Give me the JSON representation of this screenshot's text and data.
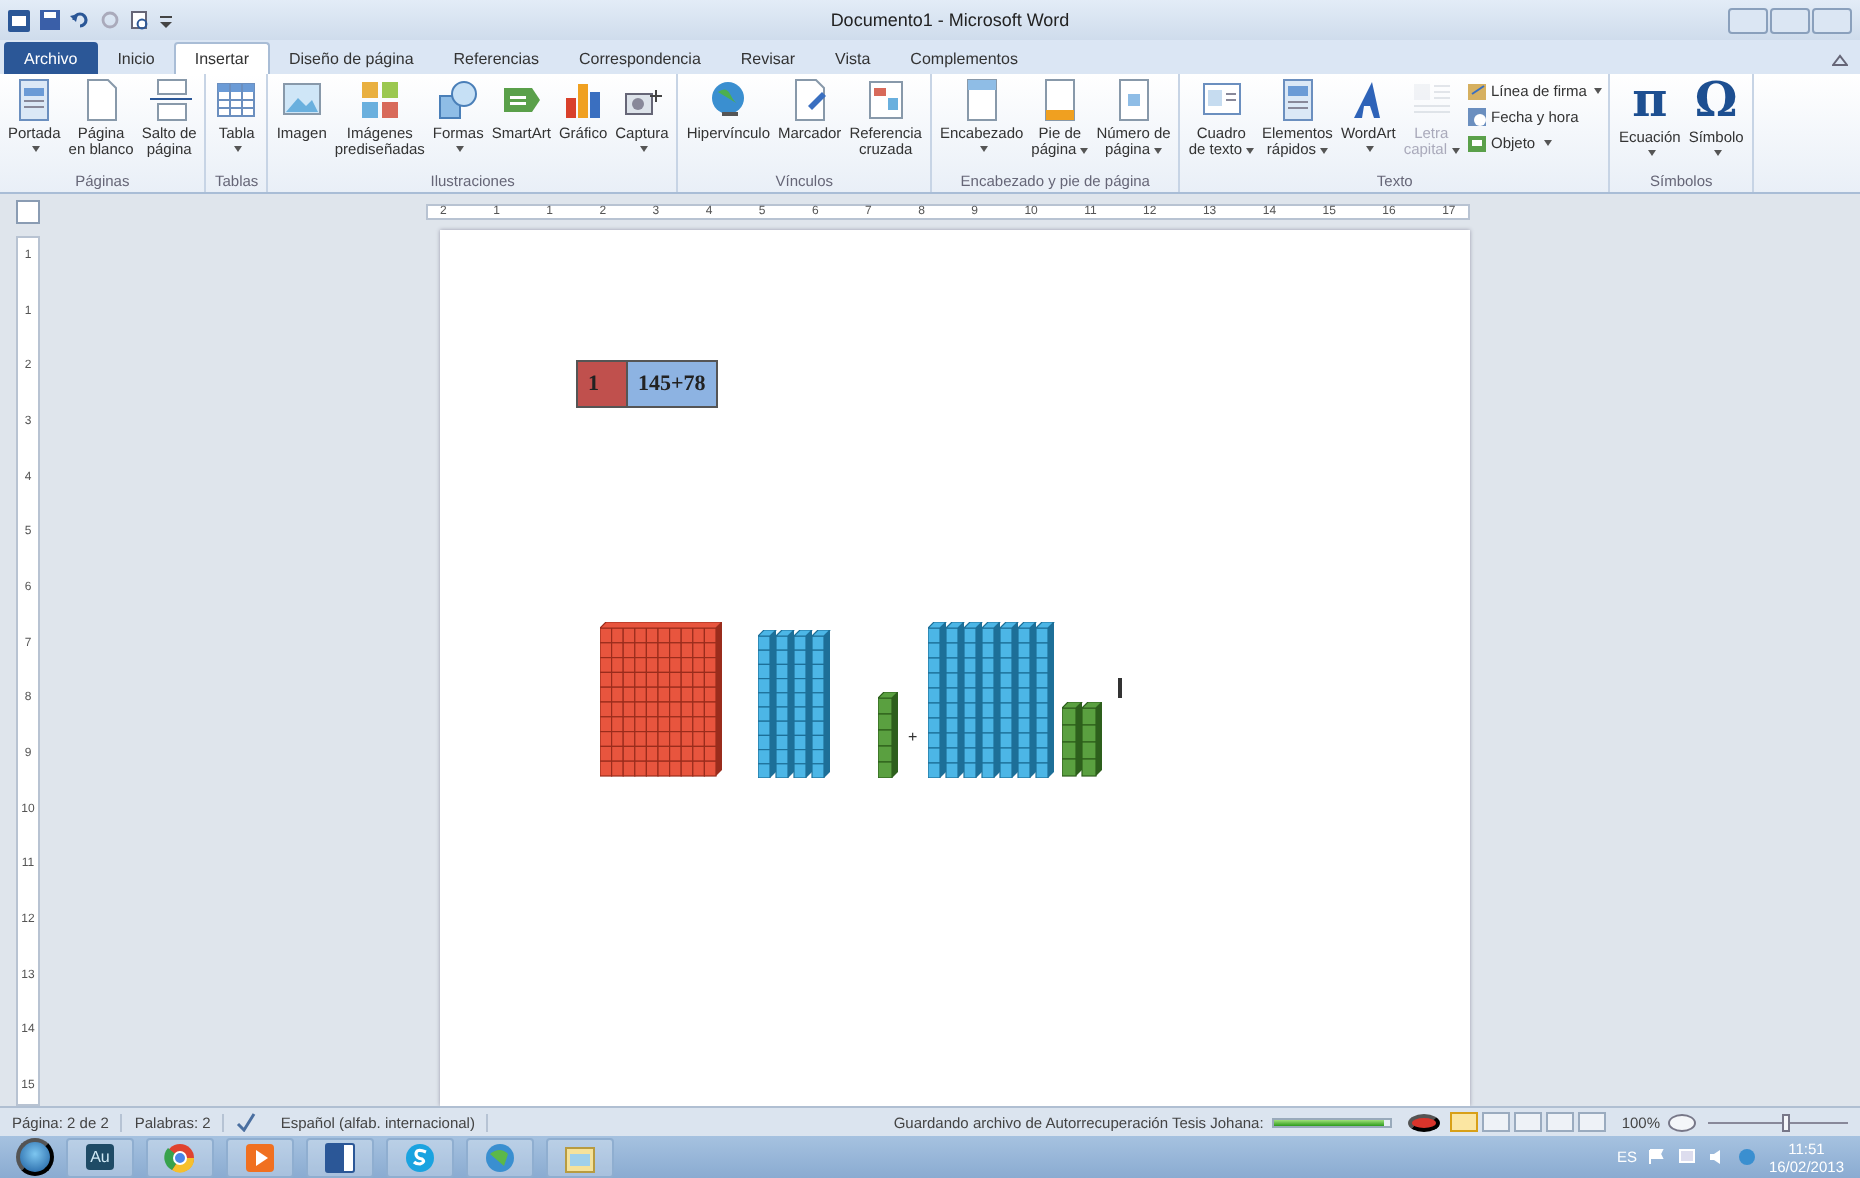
{
  "title_bar": {
    "title": "Documento1 - Microsoft Word"
  },
  "tabs": [
    {
      "label": "Archivo",
      "kind": "file",
      "selected": false
    },
    {
      "label": "Inicio",
      "kind": "tab",
      "selected": false
    },
    {
      "label": "Insertar",
      "kind": "tab",
      "selected": true
    },
    {
      "label": "Diseño de página",
      "kind": "tab",
      "selected": false
    },
    {
      "label": "Referencias",
      "kind": "tab",
      "selected": false
    },
    {
      "label": "Correspondencia",
      "kind": "tab",
      "selected": false
    },
    {
      "label": "Revisar",
      "kind": "tab",
      "selected": false
    },
    {
      "label": "Vista",
      "kind": "tab",
      "selected": false
    },
    {
      "label": "Complementos",
      "kind": "tab",
      "selected": false
    }
  ],
  "ribbon": {
    "groups": [
      {
        "label": "Páginas",
        "buttons": [
          {
            "kind": "large",
            "lines": [
              "Portada"
            ],
            "dropdown": true,
            "disabled": false
          },
          {
            "kind": "large",
            "lines": [
              "Página",
              "en blanco"
            ],
            "dropdown": false,
            "disabled": false
          },
          {
            "kind": "large",
            "lines": [
              "Salto de",
              "página"
            ],
            "dropdown": false,
            "disabled": false
          }
        ]
      },
      {
        "label": "Tablas",
        "buttons": [
          {
            "kind": "large",
            "lines": [
              "Tabla"
            ],
            "dropdown": true,
            "disabled": false
          }
        ]
      },
      {
        "label": "Ilustraciones",
        "buttons": [
          {
            "kind": "large",
            "lines": [
              "Imagen"
            ],
            "dropdown": false,
            "disabled": false
          },
          {
            "kind": "large",
            "lines": [
              "Imágenes",
              "prediseñadas"
            ],
            "dropdown": false,
            "disabled": false
          },
          {
            "kind": "large",
            "lines": [
              "Formas"
            ],
            "dropdown": true,
            "disabled": false
          },
          {
            "kind": "large",
            "lines": [
              "SmartArt"
            ],
            "dropdown": false,
            "disabled": false
          },
          {
            "kind": "large",
            "lines": [
              "Gráfico"
            ],
            "dropdown": false,
            "disabled": false
          },
          {
            "kind": "large",
            "lines": [
              "Captura"
            ],
            "dropdown": true,
            "disabled": false
          }
        ]
      },
      {
        "label": "Vínculos",
        "buttons": [
          {
            "kind": "large",
            "lines": [
              "Hipervínculo"
            ],
            "dropdown": false,
            "disabled": false
          },
          {
            "kind": "large",
            "lines": [
              "Marcador"
            ],
            "dropdown": false,
            "disabled": false
          },
          {
            "kind": "large",
            "lines": [
              "Referencia",
              "cruzada"
            ],
            "dropdown": false,
            "disabled": false
          }
        ]
      },
      {
        "label": "Encabezado y pie de página",
        "buttons": [
          {
            "kind": "large",
            "lines": [
              "Encabezado"
            ],
            "dropdown": true,
            "disabled": false
          },
          {
            "kind": "large",
            "lines": [
              "Pie de",
              "página"
            ],
            "dropdown": true,
            "disabled": false
          },
          {
            "kind": "large",
            "lines": [
              "Número de",
              "página"
            ],
            "dropdown": true,
            "disabled": false
          }
        ]
      },
      {
        "label": "Texto",
        "buttons": [
          {
            "kind": "large",
            "lines": [
              "Cuadro",
              "de texto"
            ],
            "dropdown": true,
            "disabled": false
          },
          {
            "kind": "large",
            "lines": [
              "Elementos",
              "rápidos"
            ],
            "dropdown": true,
            "disabled": false
          },
          {
            "kind": "large",
            "lines": [
              "WordArt"
            ],
            "dropdown": true,
            "disabled": false
          },
          {
            "kind": "large",
            "lines": [
              "Letra",
              "capital"
            ],
            "dropdown": true,
            "disabled": true
          },
          {
            "kind": "small",
            "lines": [
              "Línea de firma"
            ],
            "dropdown": true,
            "disabled": false
          },
          {
            "kind": "small",
            "lines": [
              "Fecha y hora"
            ],
            "dropdown": false,
            "disabled": false
          },
          {
            "kind": "small",
            "lines": [
              "Objeto"
            ],
            "dropdown": true,
            "disabled": false
          }
        ]
      },
      {
        "label": "Símbolos",
        "buttons": [
          {
            "kind": "glyph",
            "glyph": "π",
            "lines": [
              "Ecuación"
            ],
            "dropdown": true,
            "disabled": false
          },
          {
            "kind": "glyph",
            "glyph": "Ω",
            "lines": [
              "Símbolo"
            ],
            "dropdown": true,
            "disabled": false
          }
        ]
      }
    ]
  },
  "ruler": {
    "horizontal": [
      "2",
      "1",
      "1",
      "2",
      "3",
      "4",
      "5",
      "6",
      "7",
      "8",
      "9",
      "10",
      "11",
      "12",
      "13",
      "14",
      "15",
      "16",
      "17"
    ],
    "vertical": [
      "1",
      "1",
      "2",
      "3",
      "4",
      "5",
      "6",
      "7",
      "8",
      "9",
      "10",
      "11",
      "12",
      "13",
      "14",
      "15"
    ]
  },
  "document": {
    "table": {
      "cells": [
        {
          "text": "1",
          "color": "#c0504d"
        },
        {
          "text": "145+78",
          "color": "#8db3e2"
        }
      ]
    },
    "blocks": {
      "operator": "+"
    }
  },
  "status_bar": {
    "items": [
      "Página: 2 de 2",
      "Palabras: 2",
      "Español (alfab. internacional)"
    ],
    "autosave": {
      "text": "Guardando archivo de Autorrecuperación Tesis Johana:",
      "level": 0.95
    },
    "views": [
      {
        "selected": true
      },
      {
        "selected": false
      },
      {
        "selected": false
      },
      {
        "selected": false
      },
      {
        "selected": false
      }
    ],
    "zoom": {
      "reading": "100%",
      "level": 0.55
    }
  },
  "taskbar": {
    "app_label": "Au",
    "language": "ES",
    "time": "11:51",
    "date": "16/02/2013"
  }
}
